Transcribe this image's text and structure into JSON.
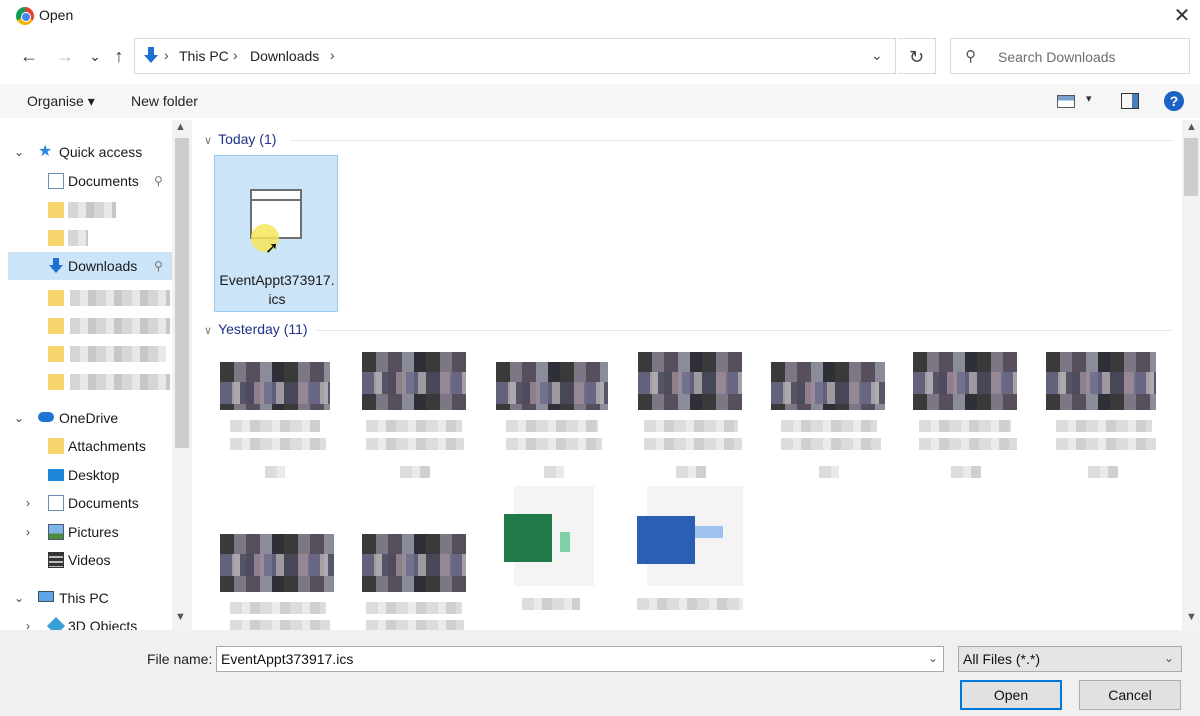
{
  "window": {
    "title": "Open",
    "close": "✕"
  },
  "nav_buttons": {
    "back": "←",
    "forward": "→",
    "recent": "⌄",
    "up": "↑"
  },
  "address": {
    "crumbs": [
      "This PC",
      "Downloads"
    ],
    "sep": "›",
    "dropdown": "⌄",
    "refresh": "↻"
  },
  "search": {
    "placeholder": "Search Downloads",
    "icon": "search-icon"
  },
  "toolbar": {
    "organise": "Organise ▾",
    "new_folder": "New folder",
    "view_dropdown": "▾",
    "help": "?"
  },
  "sidebar": {
    "quick_access": "Quick access",
    "items": [
      {
        "label": "Documents",
        "icon": "documents-icon"
      },
      {
        "label": "Downloads",
        "icon": "downloads-icon"
      },
      {
        "label": "OneDrive",
        "icon": "onedrive-icon"
      },
      {
        "label": "Attachments",
        "icon": "folder-icon"
      },
      {
        "label": "Desktop",
        "icon": "desktop-icon"
      },
      {
        "label": "Documents",
        "icon": "documents-icon"
      },
      {
        "label": "Pictures",
        "icon": "pictures-icon"
      },
      {
        "label": "Videos",
        "icon": "videos-icon"
      },
      {
        "label": "This PC",
        "icon": "computer-icon"
      },
      {
        "label": "3D Objects",
        "icon": "3d-objects-icon"
      }
    ],
    "expand": "›",
    "collapse": "⌄",
    "pin": "📌"
  },
  "content": {
    "groups": [
      {
        "label": "Today (1)"
      },
      {
        "label": "Yesterday (11)"
      }
    ],
    "selected_file": {
      "name": "EventAppt373917.ics"
    }
  },
  "bottom": {
    "file_name_label": "File name:",
    "file_name_value": "EventAppt373917.ics",
    "file_type": "All Files (*.*)",
    "open": "Open",
    "cancel": "Cancel"
  }
}
